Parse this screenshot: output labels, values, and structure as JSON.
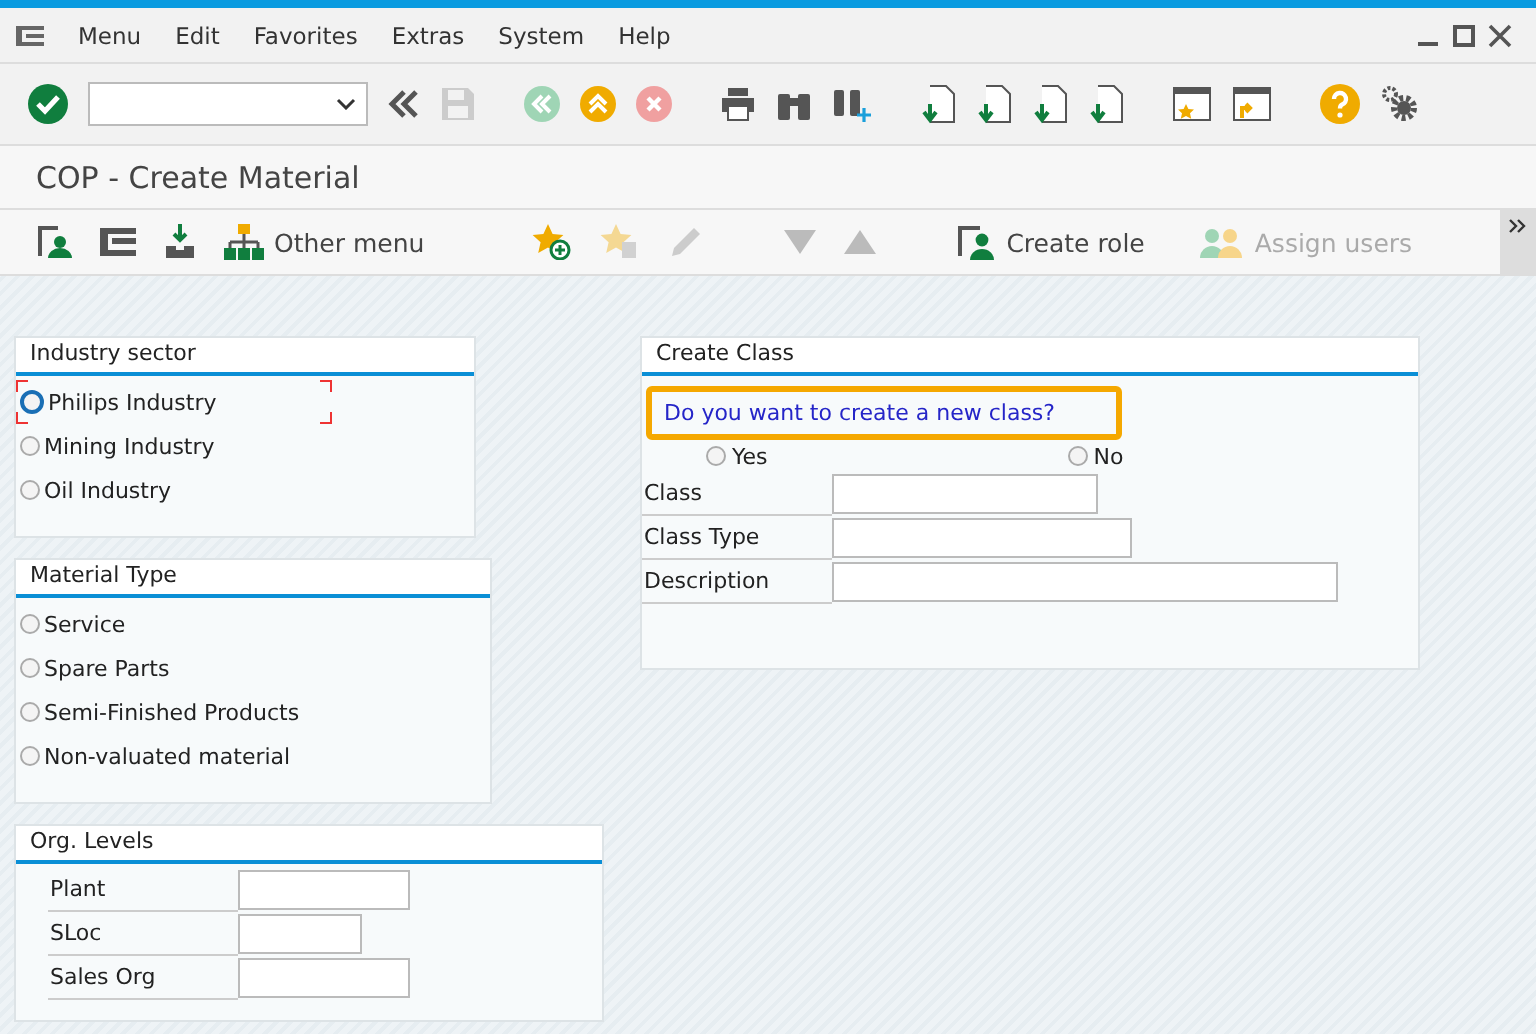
{
  "menu_bar": {
    "items": [
      "Menu",
      "Edit",
      "Favorites",
      "Extras",
      "System",
      "Help"
    ]
  },
  "screen_title": "COP - Create Material",
  "app_toolbar": {
    "other_menu": "Other menu",
    "create_role": "Create role",
    "assign_users": "Assign users",
    "assign_users_disabled": true
  },
  "industry_sector": {
    "title": "Industry sector",
    "options": [
      {
        "label": "Philips Industry",
        "selected": false,
        "focused": true
      },
      {
        "label": "Mining Industry",
        "selected": false,
        "focused": false
      },
      {
        "label": "Oil Industry",
        "selected": false,
        "focused": false
      }
    ]
  },
  "material_type": {
    "title": "Material Type",
    "options": [
      {
        "label": "Service",
        "selected": false
      },
      {
        "label": "Spare Parts",
        "selected": false
      },
      {
        "label": "Semi-Finished Products",
        "selected": false
      },
      {
        "label": "Non-valuated material",
        "selected": false
      }
    ]
  },
  "org_levels": {
    "title": "Org. Levels",
    "fields": [
      {
        "label": "Plant"
      },
      {
        "label": "SLoc"
      },
      {
        "label": "Sales Org"
      }
    ]
  },
  "create_class": {
    "title": "Create Class",
    "question": "Do you want to create a new class?",
    "highlighted": true,
    "answers": [
      {
        "label": "Yes",
        "selected": false
      },
      {
        "label": "No",
        "selected": false
      }
    ],
    "fields": [
      {
        "label": "Class"
      },
      {
        "label": "Class Type"
      },
      {
        "label": "Description"
      }
    ]
  }
}
